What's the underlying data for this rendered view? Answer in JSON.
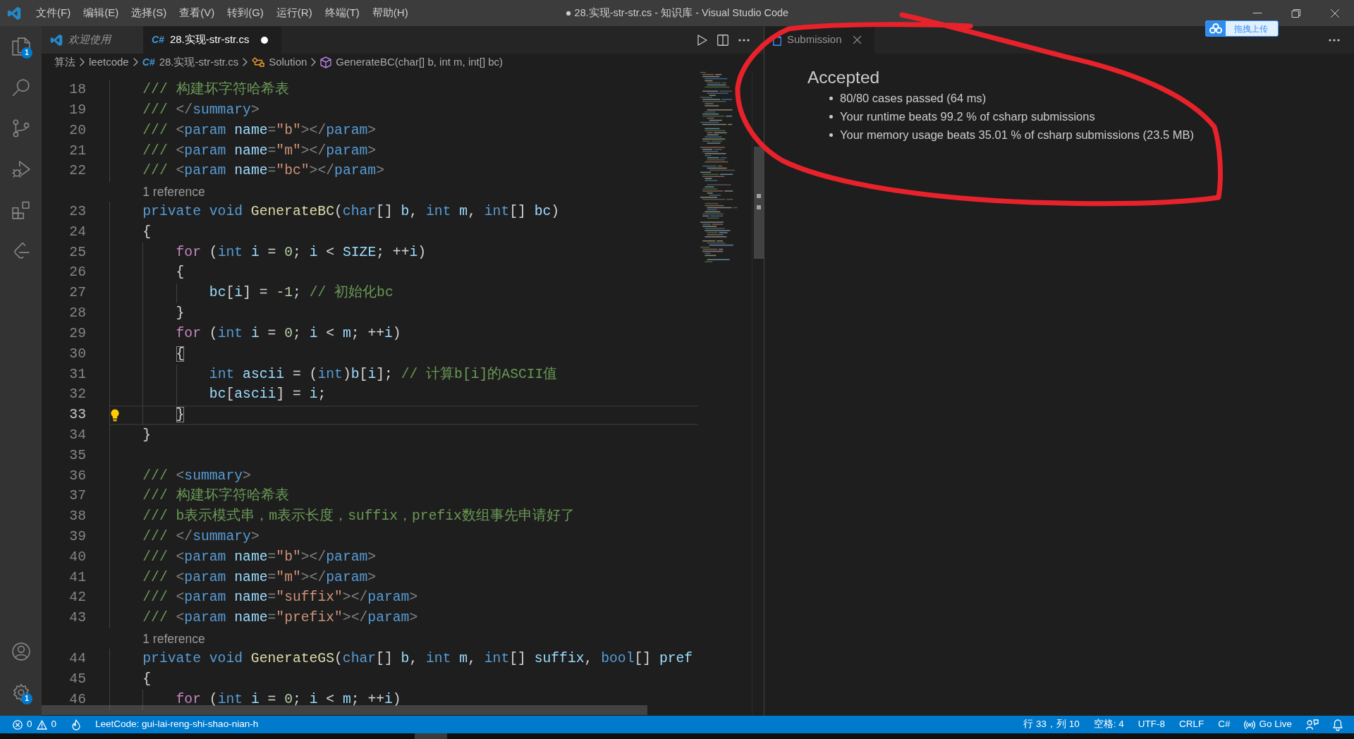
{
  "window": {
    "title": "● 28.实现-str-str.cs - 知识库 - Visual Studio Code",
    "menu": [
      "文件(F)",
      "编辑(E)",
      "选择(S)",
      "查看(V)",
      "转到(G)",
      "运行(R)",
      "终端(T)",
      "帮助(H)"
    ],
    "controls": [
      {
        "kind": "minimize"
      },
      {
        "kind": "restore"
      },
      {
        "kind": "close"
      }
    ]
  },
  "overlay_button": {
    "text": "拖拽上传"
  },
  "activity_bar": {
    "top": [
      {
        "kind": "explorer",
        "badge": "1"
      },
      {
        "kind": "search"
      },
      {
        "kind": "source-control"
      },
      {
        "kind": "run-debug"
      },
      {
        "kind": "extensions"
      },
      {
        "kind": "leetcode"
      }
    ],
    "bottom": [
      {
        "kind": "accounts"
      },
      {
        "kind": "manage",
        "badge": "1"
      }
    ]
  },
  "editor": {
    "focused": true,
    "tabs": [
      {
        "kind": "welcome",
        "label": "欢迎使用",
        "selected": false,
        "preview": true,
        "dirty": false
      },
      {
        "kind": "csharp",
        "file_icon": "C#",
        "label": "28.实现-str-str.cs",
        "selected": true,
        "preview": false,
        "dirty": true
      }
    ],
    "actions": [
      {
        "kind": "run"
      },
      {
        "kind": "split"
      },
      {
        "kind": "more"
      }
    ],
    "breadcrumbs": [
      {
        "kind": "folder",
        "label": "算法"
      },
      {
        "kind": "folder",
        "label": "leetcode"
      },
      {
        "kind": "file",
        "file_icon": "C#",
        "label": "28.实现-str-str.cs"
      },
      {
        "kind": "class",
        "label": "Solution"
      },
      {
        "kind": "method",
        "label": "GenerateBC(char[] b, int m, int[] bc)"
      }
    ],
    "lines": [
      {
        "kind": "code",
        "number": "18",
        "current": false,
        "lightbulb": false,
        "tokens": [
          {
            "text": "/// 构建坏字符哈希表",
            "kind": "doc"
          }
        ]
      },
      {
        "kind": "code",
        "number": "19",
        "current": false,
        "lightbulb": false,
        "tokens": [
          {
            "text": "/// ",
            "kind": "doc"
          },
          {
            "text": "</",
            "kind": "tag"
          },
          {
            "text": "summary",
            "kind": "tagname"
          },
          {
            "text": ">",
            "kind": "tag"
          }
        ]
      },
      {
        "kind": "code",
        "number": "20",
        "current": false,
        "lightbulb": false,
        "tokens": [
          {
            "text": "/// ",
            "kind": "doc"
          },
          {
            "text": "<",
            "kind": "tag"
          },
          {
            "text": "param",
            "kind": "tagname"
          },
          {
            "text": " name",
            "kind": "attr"
          },
          {
            "text": "=",
            "kind": "tag"
          },
          {
            "text": "\"b\"",
            "kind": "attrval"
          },
          {
            "text": "></",
            "kind": "tag"
          },
          {
            "text": "param",
            "kind": "tagname"
          },
          {
            "text": ">",
            "kind": "tag"
          }
        ]
      },
      {
        "kind": "code",
        "number": "21",
        "current": false,
        "lightbulb": false,
        "tokens": [
          {
            "text": "/// ",
            "kind": "doc"
          },
          {
            "text": "<",
            "kind": "tag"
          },
          {
            "text": "param",
            "kind": "tagname"
          },
          {
            "text": " name",
            "kind": "attr"
          },
          {
            "text": "=",
            "kind": "tag"
          },
          {
            "text": "\"m\"",
            "kind": "attrval"
          },
          {
            "text": "></",
            "kind": "tag"
          },
          {
            "text": "param",
            "kind": "tagname"
          },
          {
            "text": ">",
            "kind": "tag"
          }
        ]
      },
      {
        "kind": "code",
        "number": "22",
        "current": false,
        "lightbulb": false,
        "tokens": [
          {
            "text": "/// ",
            "kind": "doc"
          },
          {
            "text": "<",
            "kind": "tag"
          },
          {
            "text": "param",
            "kind": "tagname"
          },
          {
            "text": " name",
            "kind": "attr"
          },
          {
            "text": "=",
            "kind": "tag"
          },
          {
            "text": "\"bc\"",
            "kind": "attrval"
          },
          {
            "text": "></",
            "kind": "tag"
          },
          {
            "text": "param",
            "kind": "tagname"
          },
          {
            "text": ">",
            "kind": "tag"
          }
        ]
      },
      {
        "kind": "codelens",
        "text": "1 reference"
      },
      {
        "kind": "code",
        "number": "23",
        "current": false,
        "lightbulb": false,
        "tokens": [
          {
            "text": "private void ",
            "kind": "kw"
          },
          {
            "text": "GenerateBC",
            "kind": "fn"
          },
          {
            "text": "(",
            "kind": "punc"
          },
          {
            "text": "char",
            "kind": "kw"
          },
          {
            "text": "[] ",
            "kind": "punc"
          },
          {
            "text": "b",
            "kind": "var"
          },
          {
            "text": ", ",
            "kind": "punc"
          },
          {
            "text": "int",
            "kind": "kw"
          },
          {
            "text": " m",
            "kind": "var"
          },
          {
            "text": ", ",
            "kind": "punc"
          },
          {
            "text": "int",
            "kind": "kw"
          },
          {
            "text": "[] ",
            "kind": "punc"
          },
          {
            "text": "bc",
            "kind": "var"
          },
          {
            "text": ")",
            "kind": "punc"
          }
        ]
      },
      {
        "kind": "code",
        "number": "24",
        "current": false,
        "lightbulb": false,
        "tokens": [
          {
            "text": "{",
            "kind": "punc"
          }
        ],
        "children": [
          {
            "kind": "code",
            "number": "25",
            "current": false,
            "lightbulb": false,
            "tokens": [
              {
                "text": "for",
                "kind": "ctrl"
              },
              {
                "text": " (",
                "kind": "punc"
              },
              {
                "text": "int",
                "kind": "kw"
              },
              {
                "text": " i",
                "kind": "var"
              },
              {
                "text": " = ",
                "kind": "punc"
              },
              {
                "text": "0",
                "kind": "num"
              },
              {
                "text": "; ",
                "kind": "punc"
              },
              {
                "text": "i",
                "kind": "var"
              },
              {
                "text": " < ",
                "kind": "punc"
              },
              {
                "text": "SIZE",
                "kind": "var"
              },
              {
                "text": "; ++",
                "kind": "punc"
              },
              {
                "text": "i",
                "kind": "var"
              },
              {
                "text": ")",
                "kind": "punc"
              }
            ]
          },
          {
            "kind": "code",
            "number": "26",
            "current": false,
            "lightbulb": false,
            "tokens": [
              {
                "text": "{",
                "kind": "punc"
              }
            ],
            "children": [
              {
                "kind": "code",
                "number": "27",
                "current": false,
                "lightbulb": false,
                "tokens": [
                  {
                    "text": "bc",
                    "kind": "var"
                  },
                  {
                    "text": "[",
                    "kind": "punc"
                  },
                  {
                    "text": "i",
                    "kind": "var"
                  },
                  {
                    "text": "] = ",
                    "kind": "punc"
                  },
                  {
                    "text": "-1",
                    "kind": "num"
                  },
                  {
                    "text": "; ",
                    "kind": "punc"
                  },
                  {
                    "text": "// 初始化bc",
                    "kind": "comment"
                  }
                ]
              }
            ]
          },
          {
            "kind": "code",
            "number": "28",
            "current": false,
            "lightbulb": false,
            "tokens": [
              {
                "text": "}",
                "kind": "punc"
              }
            ]
          },
          {
            "kind": "code",
            "number": "29",
            "current": false,
            "lightbulb": false,
            "tokens": [
              {
                "text": "for",
                "kind": "ctrl"
              },
              {
                "text": " (",
                "kind": "punc"
              },
              {
                "text": "int",
                "kind": "kw"
              },
              {
                "text": " i",
                "kind": "var"
              },
              {
                "text": " = ",
                "kind": "punc"
              },
              {
                "text": "0",
                "kind": "num"
              },
              {
                "text": "; ",
                "kind": "punc"
              },
              {
                "text": "i",
                "kind": "var"
              },
              {
                "text": " < ",
                "kind": "punc"
              },
              {
                "text": "m",
                "kind": "var"
              },
              {
                "text": "; ++",
                "kind": "punc"
              },
              {
                "text": "i",
                "kind": "var"
              },
              {
                "text": ")",
                "kind": "punc"
              }
            ]
          },
          {
            "kind": "code",
            "number": "30",
            "current": false,
            "lightbulb": false,
            "tokens": [
              {
                "text": "{",
                "kind": "bracket-match"
              }
            ],
            "children": [
              {
                "kind": "code",
                "number": "31",
                "current": false,
                "lightbulb": false,
                "tokens": [
                  {
                    "text": "int",
                    "kind": "kw"
                  },
                  {
                    "text": " ascii",
                    "kind": "var"
                  },
                  {
                    "text": " = (",
                    "kind": "punc"
                  },
                  {
                    "text": "int",
                    "kind": "kw"
                  },
                  {
                    "text": ")",
                    "kind": "punc"
                  },
                  {
                    "text": "b",
                    "kind": "var"
                  },
                  {
                    "text": "[",
                    "kind": "punc"
                  },
                  {
                    "text": "i",
                    "kind": "var"
                  },
                  {
                    "text": "]; ",
                    "kind": "punc"
                  },
                  {
                    "text": "// 计算b[i]的ASCII值",
                    "kind": "comment"
                  }
                ]
              },
              {
                "kind": "code",
                "number": "32",
                "current": false,
                "lightbulb": false,
                "tokens": [
                  {
                    "text": "bc",
                    "kind": "var"
                  },
                  {
                    "text": "[",
                    "kind": "punc"
                  },
                  {
                    "text": "ascii",
                    "kind": "var"
                  },
                  {
                    "text": "] = ",
                    "kind": "punc"
                  },
                  {
                    "text": "i",
                    "kind": "var"
                  },
                  {
                    "text": ";",
                    "kind": "punc"
                  }
                ]
              }
            ]
          },
          {
            "kind": "code",
            "number": "33",
            "current": true,
            "lightbulb": true,
            "tokens": [
              {
                "text": "}",
                "kind": "bracket-match"
              }
            ]
          }
        ]
      },
      {
        "kind": "code",
        "number": "34",
        "current": false,
        "lightbulb": false,
        "tokens": [
          {
            "text": "}",
            "kind": "punc"
          }
        ]
      },
      {
        "kind": "code",
        "number": "35",
        "current": false,
        "lightbulb": false
      },
      {
        "kind": "code",
        "number": "36",
        "current": false,
        "lightbulb": false,
        "tokens": [
          {
            "text": "/// ",
            "kind": "doc"
          },
          {
            "text": "<",
            "kind": "tag"
          },
          {
            "text": "summary",
            "kind": "tagname"
          },
          {
            "text": ">",
            "kind": "tag"
          }
        ]
      },
      {
        "kind": "code",
        "number": "37",
        "current": false,
        "lightbulb": false,
        "tokens": [
          {
            "text": "/// 构建坏字符哈希表",
            "kind": "doc"
          }
        ]
      },
      {
        "kind": "code",
        "number": "38",
        "current": false,
        "lightbulb": false,
        "tokens": [
          {
            "text": "/// b表示模式串，m表示长度，suffix，prefix数组事先申请好了",
            "kind": "doc"
          }
        ]
      },
      {
        "kind": "code",
        "number": "39",
        "current": false,
        "lightbulb": false,
        "tokens": [
          {
            "text": "/// ",
            "kind": "doc"
          },
          {
            "text": "</",
            "kind": "tag"
          },
          {
            "text": "summary",
            "kind": "tagname"
          },
          {
            "text": ">",
            "kind": "tag"
          }
        ]
      },
      {
        "kind": "code",
        "number": "40",
        "current": false,
        "lightbulb": false,
        "tokens": [
          {
            "text": "/// ",
            "kind": "doc"
          },
          {
            "text": "<",
            "kind": "tag"
          },
          {
            "text": "param",
            "kind": "tagname"
          },
          {
            "text": " name",
            "kind": "attr"
          },
          {
            "text": "=",
            "kind": "tag"
          },
          {
            "text": "\"b\"",
            "kind": "attrval"
          },
          {
            "text": "></",
            "kind": "tag"
          },
          {
            "text": "param",
            "kind": "tagname"
          },
          {
            "text": ">",
            "kind": "tag"
          }
        ]
      },
      {
        "kind": "code",
        "number": "41",
        "current": false,
        "lightbulb": false,
        "tokens": [
          {
            "text": "/// ",
            "kind": "doc"
          },
          {
            "text": "<",
            "kind": "tag"
          },
          {
            "text": "param",
            "kind": "tagname"
          },
          {
            "text": " name",
            "kind": "attr"
          },
          {
            "text": "=",
            "kind": "tag"
          },
          {
            "text": "\"m\"",
            "kind": "attrval"
          },
          {
            "text": "></",
            "kind": "tag"
          },
          {
            "text": "param",
            "kind": "tagname"
          },
          {
            "text": ">",
            "kind": "tag"
          }
        ]
      },
      {
        "kind": "code",
        "number": "42",
        "current": false,
        "lightbulb": false,
        "tokens": [
          {
            "text": "/// ",
            "kind": "doc"
          },
          {
            "text": "<",
            "kind": "tag"
          },
          {
            "text": "param",
            "kind": "tagname"
          },
          {
            "text": " name",
            "kind": "attr"
          },
          {
            "text": "=",
            "kind": "tag"
          },
          {
            "text": "\"suffix\"",
            "kind": "attrval"
          },
          {
            "text": "></",
            "kind": "tag"
          },
          {
            "text": "param",
            "kind": "tagname"
          },
          {
            "text": ">",
            "kind": "tag"
          }
        ]
      },
      {
        "kind": "code",
        "number": "43",
        "current": false,
        "lightbulb": false,
        "tokens": [
          {
            "text": "/// ",
            "kind": "doc"
          },
          {
            "text": "<",
            "kind": "tag"
          },
          {
            "text": "param",
            "kind": "tagname"
          },
          {
            "text": " name",
            "kind": "attr"
          },
          {
            "text": "=",
            "kind": "tag"
          },
          {
            "text": "\"prefix\"",
            "kind": "attrval"
          },
          {
            "text": "></",
            "kind": "tag"
          },
          {
            "text": "param",
            "kind": "tagname"
          },
          {
            "text": ">",
            "kind": "tag"
          }
        ]
      },
      {
        "kind": "codelens",
        "text": "1 reference"
      },
      {
        "kind": "code",
        "number": "44",
        "current": false,
        "lightbulb": false,
        "tokens": [
          {
            "text": "private void ",
            "kind": "kw"
          },
          {
            "text": "GenerateGS",
            "kind": "fn"
          },
          {
            "text": "(",
            "kind": "punc"
          },
          {
            "text": "char",
            "kind": "kw"
          },
          {
            "text": "[] ",
            "kind": "punc"
          },
          {
            "text": "b",
            "kind": "var"
          },
          {
            "text": ", ",
            "kind": "punc"
          },
          {
            "text": "int",
            "kind": "kw"
          },
          {
            "text": " m",
            "kind": "var"
          },
          {
            "text": ", ",
            "kind": "punc"
          },
          {
            "text": "int",
            "kind": "kw"
          },
          {
            "text": "[] ",
            "kind": "punc"
          },
          {
            "text": "suffix",
            "kind": "var"
          },
          {
            "text": ", ",
            "kind": "punc"
          },
          {
            "text": "bool",
            "kind": "kw"
          },
          {
            "text": "[] ",
            "kind": "punc"
          },
          {
            "text": "pref",
            "kind": "var"
          }
        ]
      },
      {
        "kind": "code",
        "number": "45",
        "current": false,
        "lightbulb": false,
        "tokens": [
          {
            "text": "{",
            "kind": "punc"
          }
        ],
        "children": [
          {
            "kind": "code",
            "number": "46",
            "current": false,
            "lightbulb": false,
            "tokens": [
              {
                "text": "for",
                "kind": "ctrl"
              },
              {
                "text": " (",
                "kind": "punc"
              },
              {
                "text": "int",
                "kind": "kw"
              },
              {
                "text": " i",
                "kind": "var"
              },
              {
                "text": " = ",
                "kind": "punc"
              },
              {
                "text": "0",
                "kind": "num"
              },
              {
                "text": "; ",
                "kind": "punc"
              },
              {
                "text": "i",
                "kind": "var"
              },
              {
                "text": " < ",
                "kind": "punc"
              },
              {
                "text": "m",
                "kind": "var"
              },
              {
                "text": "; ++",
                "kind": "punc"
              },
              {
                "text": "i",
                "kind": "var"
              },
              {
                "text": ")",
                "kind": "punc"
              }
            ]
          }
        ]
      }
    ]
  },
  "submission": {
    "focused": false,
    "tabs": [
      {
        "kind": "file",
        "label": "Submission",
        "selected": true,
        "preview": false,
        "dirty": false
      }
    ],
    "actions": [
      {
        "kind": "more"
      }
    ],
    "heading": "Accepted",
    "results": [
      "80/80 cases passed (64 ms)",
      "Your runtime beats 99.2 % of csharp submissions",
      "Your memory usage beats 35.01 % of csharp submissions (23.5 MB)"
    ]
  },
  "status_bar": {
    "left": [
      {
        "kind": "errors",
        "text": "0"
      },
      {
        "kind": "warnings",
        "text": "0"
      },
      {
        "kind": "flame"
      },
      {
        "kind": "text",
        "text": "LeetCode: gui-lai-reng-shi-shao-nian-h"
      }
    ],
    "right": [
      {
        "kind": "text",
        "text": "行 33，列 10"
      },
      {
        "kind": "text",
        "text": "空格: 4"
      },
      {
        "kind": "text",
        "text": "UTF-8"
      },
      {
        "kind": "text",
        "text": "CRLF"
      },
      {
        "kind": "text",
        "text": "C#"
      },
      {
        "kind": "golive",
        "text": "Go Live"
      },
      {
        "kind": "feedback"
      },
      {
        "kind": "bell"
      }
    ]
  },
  "annotation": {
    "kind": "loop"
  }
}
